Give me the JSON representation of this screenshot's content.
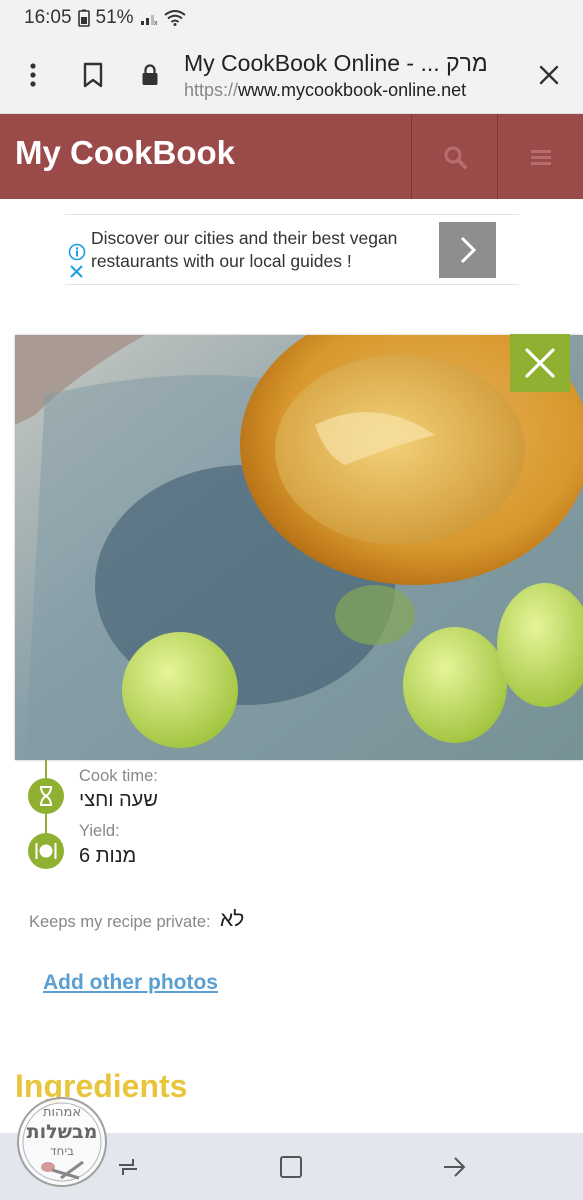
{
  "status_bar": {
    "time": "16:05",
    "battery": "51%"
  },
  "browser": {
    "page_title": "My CookBook Online - ... מרק",
    "url_scheme": "https://",
    "url_host": "www.mycookbook-online.net",
    "icons": [
      "more-vert-icon",
      "bookmark-icon",
      "lock-icon",
      "close-icon"
    ]
  },
  "header": {
    "title": "My CookBook",
    "icons": [
      "search-icon",
      "menu-icon"
    ]
  },
  "ad": {
    "text": "Discover our cities and their best vegan restaurants with our local guides !"
  },
  "recipe": {
    "cook_time_label": "Cook time:",
    "cook_time_value": "שעה וחצי",
    "yield_label": "Yield:",
    "yield_value": "6 מנות",
    "private_label": "Keeps my recipe private:",
    "private_value": "לא",
    "add_photos": "Add other photos",
    "ingredients_heading": "Ingredients"
  },
  "watermark": {
    "lines": [
      "אמהות",
      "מבשלות",
      "ביחד"
    ]
  },
  "colors": {
    "header": "#9b4a4a",
    "accent_green": "#8fb030",
    "link": "#5a9fd2",
    "heading_yellow": "#e8c53a"
  }
}
